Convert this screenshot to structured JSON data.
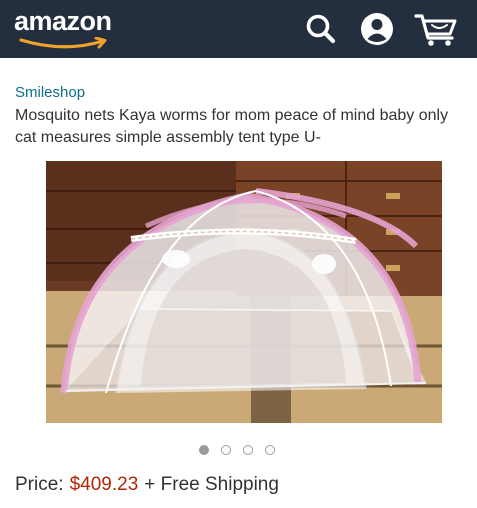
{
  "header": {
    "logo_text": "amazon",
    "background": "#232f3e",
    "icons": [
      "search-icon",
      "account-icon",
      "cart-icon"
    ]
  },
  "product": {
    "seller": "Smileshop",
    "title": "Mosquito nets Kaya worms for mom peace of mind baby only cat measures simple assembly tent type U-",
    "carousel": {
      "total": 4,
      "active": 1
    },
    "price_label": "Price:",
    "price": "$409.23",
    "shipping": "+ Free Shipping"
  },
  "colors": {
    "seller_link": "#0f6f8c",
    "price": "#b12704",
    "logo_smile": "#f0a12c"
  }
}
